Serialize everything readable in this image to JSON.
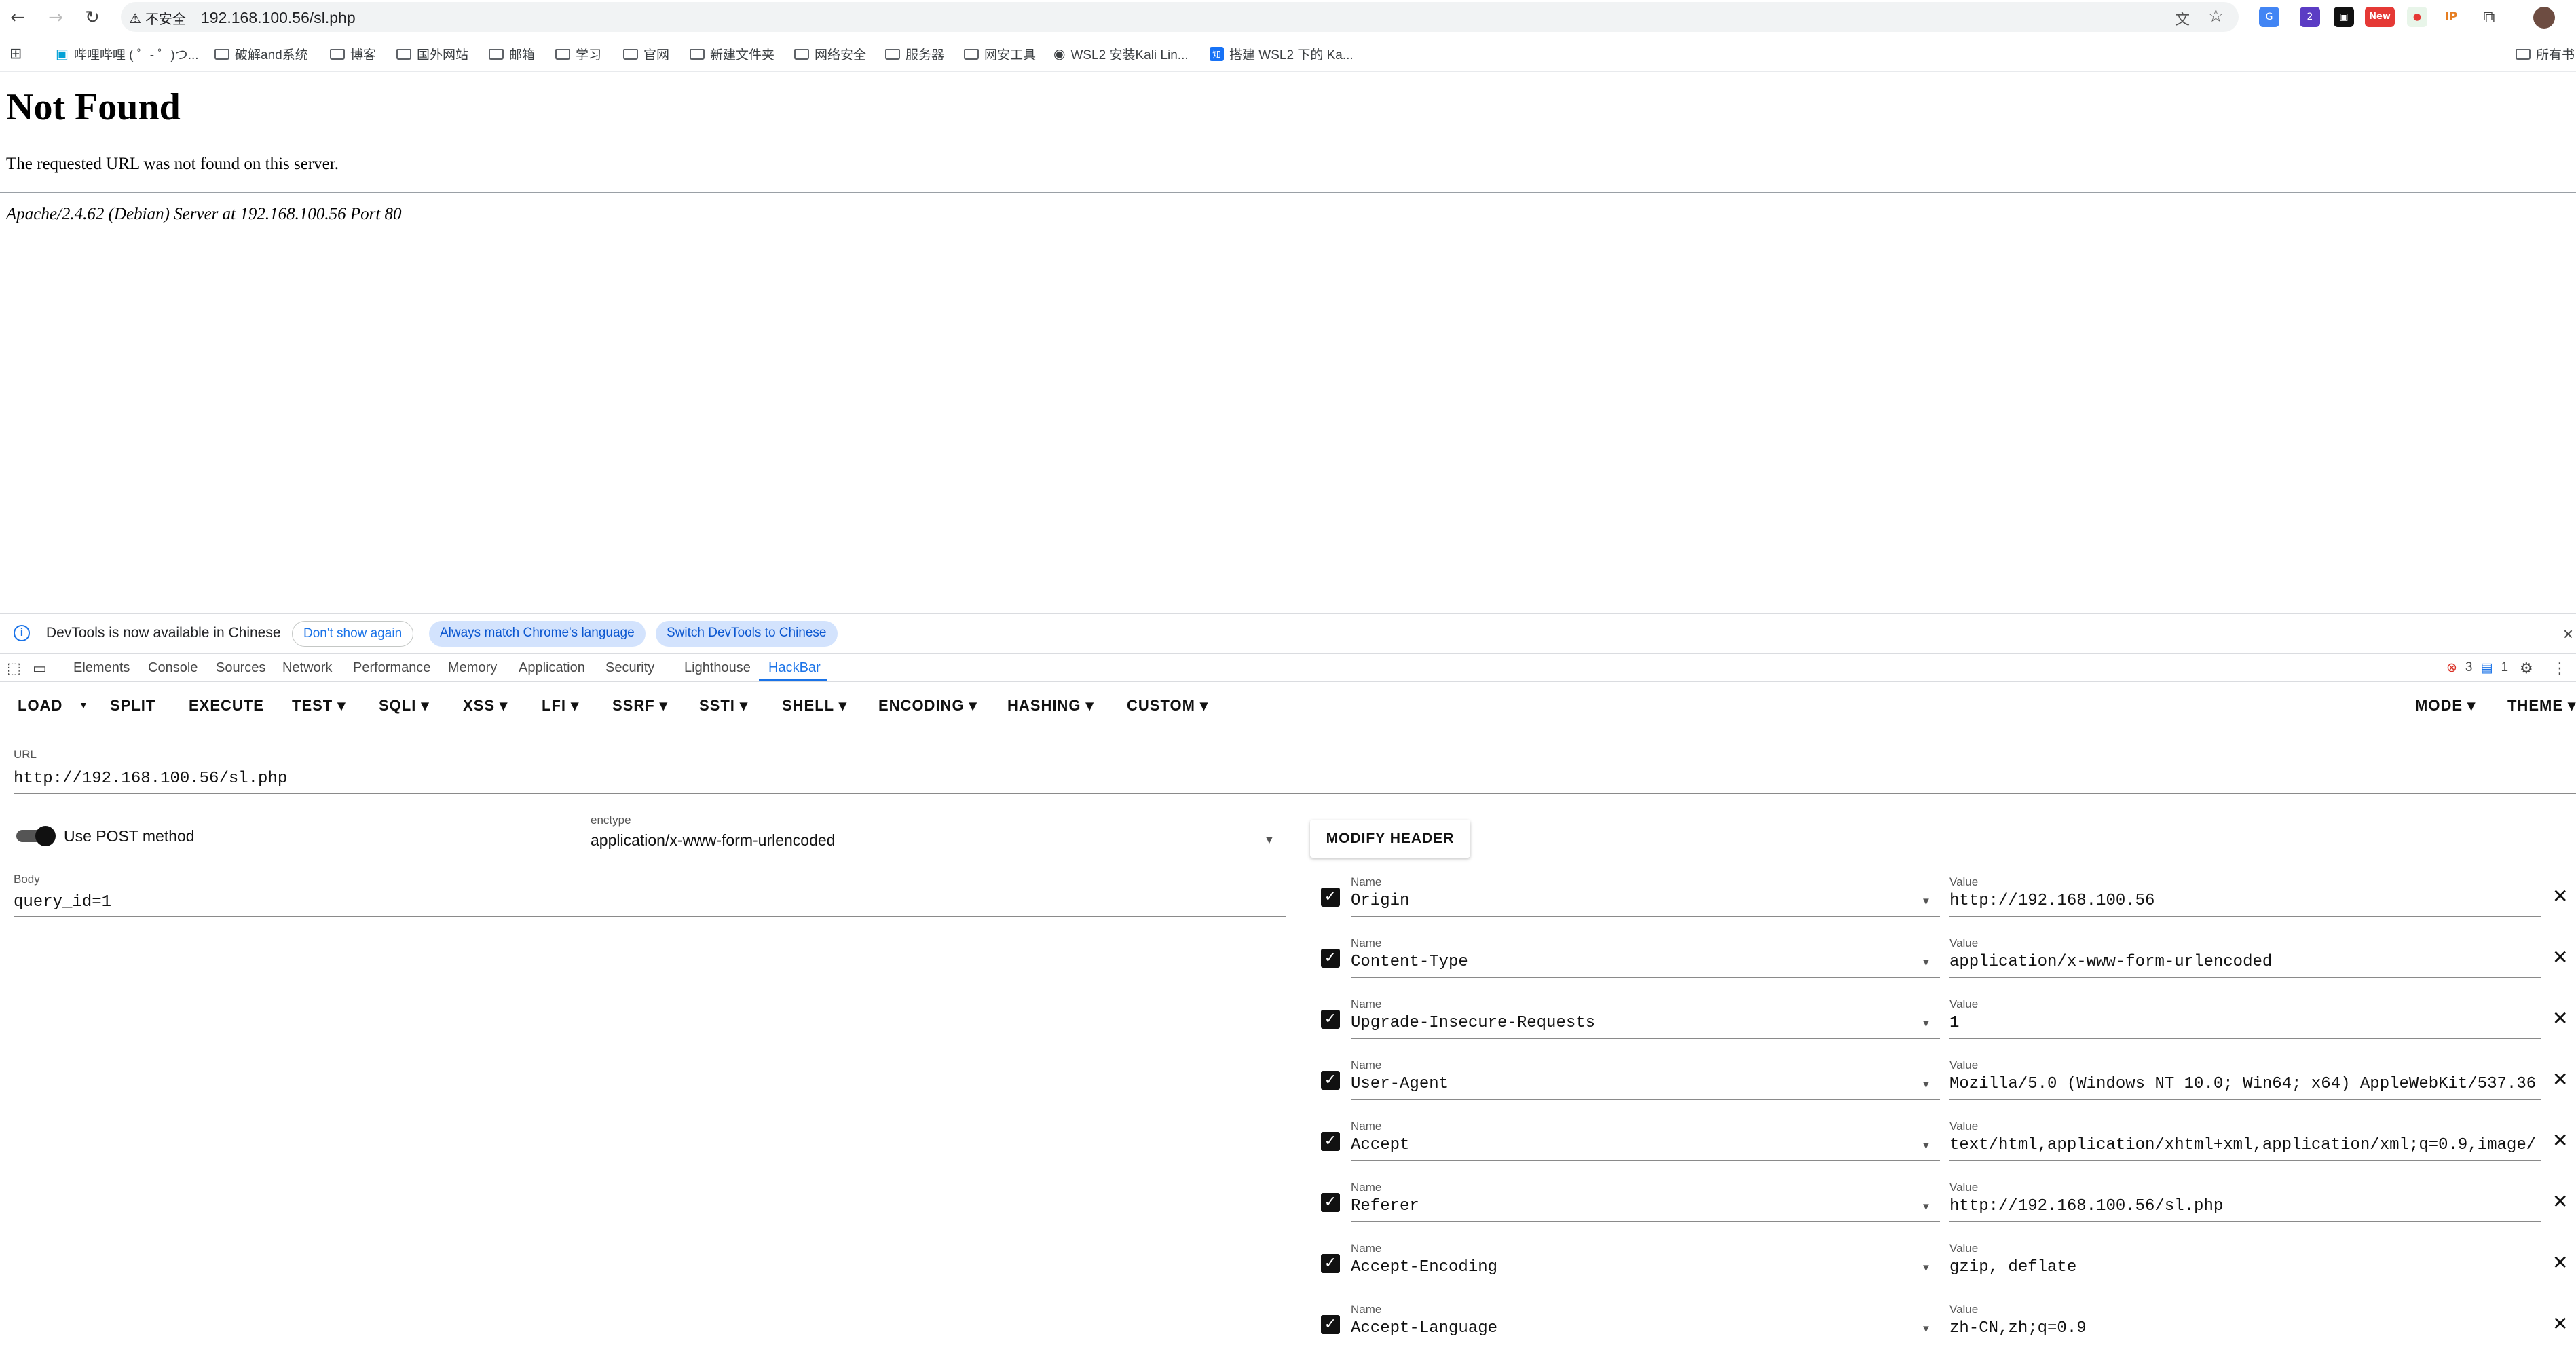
{
  "browser": {
    "insecure_label": "不安全",
    "url": "192.168.100.56/sl.php",
    "ext_new_badge": "New",
    "ext_ip_label": "IP",
    "ext_badge_count": "2"
  },
  "bookmarks": {
    "items": [
      "哔哩哔哩 ( ゜- ゜)つ...",
      "破解and系统",
      "博客",
      "国外网站",
      "邮箱",
      "学习",
      "官网",
      "新建文件夹",
      "网络安全",
      "服务器",
      "网安工具",
      "WSL2 安装Kali Lin...",
      "搭建 WSL2 下的 Ka..."
    ],
    "all_bookmarks": "所有书"
  },
  "page": {
    "title": "Not Found",
    "message": "The requested URL was not found on this server.",
    "address": "Apache/2.4.62 (Debian) Server at 192.168.100.56 Port 80"
  },
  "devtools_banner": {
    "text": "DevTools is now available in Chinese",
    "dont_show": "Don't show again",
    "always_match": "Always match Chrome's language",
    "switch": "Switch DevTools to Chinese"
  },
  "devtools_tabs": [
    "Elements",
    "Console",
    "Sources",
    "Network",
    "Performance",
    "Memory",
    "Application",
    "Security",
    "Lighthouse",
    "HackBar"
  ],
  "devtools_status": {
    "errors": "3",
    "messages": "1"
  },
  "hackbar": {
    "menu": [
      "LOAD",
      "SPLIT",
      "EXECUTE",
      "TEST",
      "SQLI",
      "XSS",
      "LFI",
      "SSRF",
      "SSTI",
      "SHELL",
      "ENCODING",
      "HASHING",
      "CUSTOM"
    ],
    "mode": "MODE",
    "theme": "THEME",
    "url_label": "URL",
    "url_value": "http://192.168.100.56/sl.php",
    "post_label": "Use POST method",
    "post_enabled": true,
    "enctype_label": "enctype",
    "enctype_value": "application/x-www-form-urlencoded",
    "body_label": "Body",
    "body_value": "query_id=1",
    "modify_header": "MODIFY HEADER",
    "name_label": "Name",
    "value_label": "Value",
    "headers": [
      {
        "name": "Origin",
        "value": "http://192.168.100.56"
      },
      {
        "name": "Content-Type",
        "value": "application/x-www-form-urlencoded"
      },
      {
        "name": "Upgrade-Insecure-Requests",
        "value": "1"
      },
      {
        "name": "User-Agent",
        "value": "Mozilla/5.0 (Windows NT 10.0; Win64; x64) AppleWebKit/537.36"
      },
      {
        "name": "Accept",
        "value": "text/html,application/xhtml+xml,application/xml;q=0.9,image/"
      },
      {
        "name": "Referer",
        "value": "http://192.168.100.56/sl.php"
      },
      {
        "name": "Accept-Encoding",
        "value": "gzip, deflate"
      },
      {
        "name": "Accept-Language",
        "value": "zh-CN,zh;q=0.9"
      }
    ]
  },
  "colors": {
    "accent": "#1a73e8",
    "pill_bg": "#d3e3fd",
    "error_red": "#d93025"
  }
}
